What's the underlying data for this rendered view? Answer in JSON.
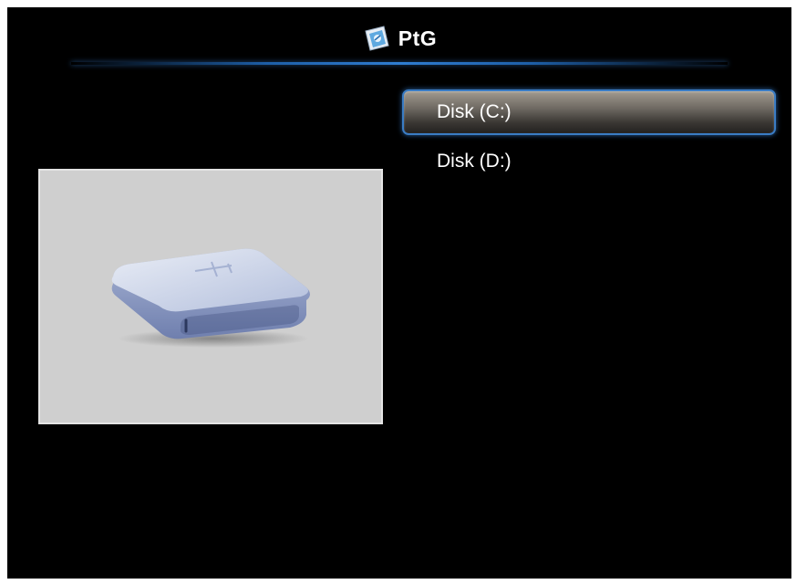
{
  "app": {
    "title": "PtG",
    "icon": "ptg-app-icon"
  },
  "preview": {
    "icon": "usb-drive-icon"
  },
  "drives": [
    {
      "label": "Disk (C:)",
      "selected": true
    },
    {
      "label": "Disk (D:)",
      "selected": false
    }
  ],
  "colors": {
    "background": "#000000",
    "accent": "#2f7dd1",
    "preview_bg": "#cfcfcf",
    "text": "#ffffff"
  }
}
